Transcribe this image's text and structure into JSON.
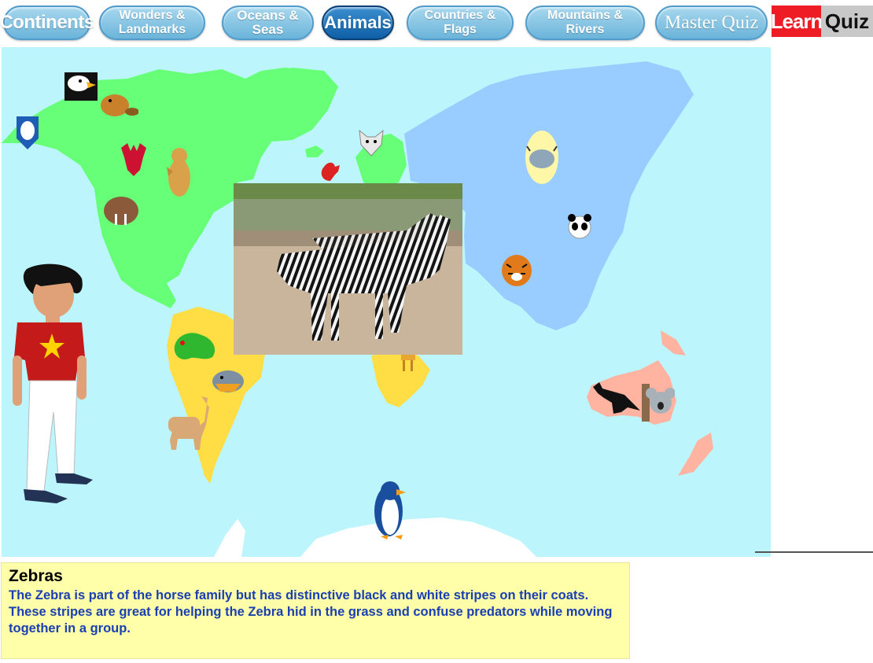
{
  "nav": {
    "tabs": [
      {
        "label": "Continents"
      },
      {
        "label": "Wonders &\nLandmarks"
      },
      {
        "label": "Oceans &\nSeas"
      },
      {
        "label": "Animals"
      },
      {
        "label": "Countries &\nFlags"
      },
      {
        "label": "Mountains &\nRivers"
      },
      {
        "label": "Master Quiz"
      }
    ],
    "active_tab": "Animals",
    "mode_learn": "Learn",
    "mode_quiz": "Quiz"
  },
  "colors": {
    "ocean": "#bdf5fd",
    "north_america": "#66ff77",
    "south_america": "#ffdd44",
    "africa": "#ffdd44",
    "europe": "#66ff77",
    "asia": "#99ccff",
    "australia": "#ffb3a0",
    "antarctica": "#ffffff",
    "info_box": "#ffffaa",
    "info_text": "#1a3fb0",
    "active_tab": "#0f5fa6",
    "learn": "#ee1c24",
    "quiz": "#c8c8c8"
  },
  "animals": [
    "bald-eagle",
    "beaver",
    "polar-bear",
    "moose",
    "grizzly-bear",
    "walrus",
    "arctic-fox",
    "red-squirrel",
    "yak",
    "panda",
    "tiger",
    "parrot",
    "piranha",
    "llama",
    "giraffe",
    "kangaroo",
    "koala",
    "penguin"
  ],
  "selected_animal": {
    "title": "Zebras",
    "description": "The Zebra is part of the horse family but has distinctive black and white stripes on their coats. These stripes are great for helping the Zebra hid in the grass and confuse predators while moving together in a group."
  }
}
